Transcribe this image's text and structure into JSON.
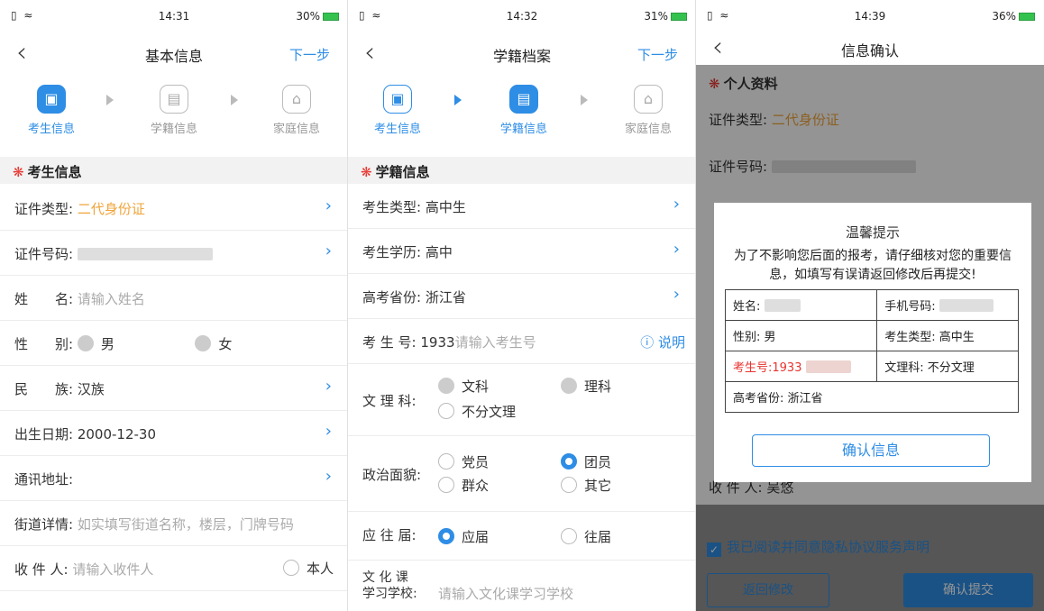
{
  "p1": {
    "status": {
      "left": "▯ ≈",
      "time": "14:31",
      "battery": "30%"
    },
    "nav": {
      "back": "‹",
      "title": "基本信息",
      "next": "下一步"
    },
    "steps": [
      "考生信息",
      "学籍信息",
      "家庭信息"
    ],
    "section": "考生信息",
    "star": "❋",
    "rows": {
      "id_type_k": "证件类型:",
      "id_type_v": "二代身份证",
      "id_no_k": "证件号码:",
      "name_k": "姓　　名:",
      "name_ph": "请输入姓名",
      "gender_k": "性　　别:",
      "male": "男",
      "female": "女",
      "nation_k": "民　　族:",
      "nation_v": "汉族",
      "birth_k": "出生日期:",
      "birth_v": "2000-12-30",
      "addr_k": "通讯地址:",
      "street_k": "街道详情:",
      "street_ph": "如实填写街道名称，楼层，门牌号码",
      "recv_k": "收 件 人:",
      "recv_ph": "请输入收件人",
      "self": "本人"
    },
    "chevron": "›"
  },
  "p2": {
    "status": {
      "left": "▯ ≈",
      "time": "14:32",
      "battery": "31%"
    },
    "nav": {
      "back": "‹",
      "title": "学籍档案",
      "next": "下一步"
    },
    "steps": [
      "考生信息",
      "学籍信息",
      "家庭信息"
    ],
    "section": "学籍信息",
    "rows": {
      "type_k": "考生类型:",
      "type_v": "高中生",
      "edu_k": "考生学历:",
      "edu_v": "高中",
      "prov_k": "高考省份:",
      "prov_v": "浙江省",
      "no_k": "考 生 号:",
      "no_v": "1933",
      "no_ph": "请输入考生号",
      "explain": "ⓘ 说明",
      "wl_k": "文 理 科:",
      "wl_1": "文科",
      "wl_2": "理科",
      "wl_3": "不分文理",
      "pol_k": "政治面貌:",
      "pol_1": "党员",
      "pol_2": "团员",
      "pol_3": "群众",
      "pol_4": "其它",
      "fresh_k": "应 往 届:",
      "fresh_1": "应届",
      "fresh_2": "往届",
      "school_k1": "文 化 课",
      "school_k2": "学习学校:",
      "school_ph": "请输入文化课学习学校"
    }
  },
  "p3": {
    "status": {
      "left": "▯ ≈",
      "time": "14:39",
      "battery": "36%"
    },
    "nav": {
      "back": "‹",
      "title": "信息确认"
    },
    "section": "个人资料",
    "bg": {
      "id_type_k": "证件类型:",
      "id_type_v": "二代身份证",
      "id_no_k": "证件号码:",
      "recv": "收 件 人: 吴悠"
    },
    "dialog": {
      "title": "温馨提示",
      "msg": "为了不影响您后面的报考，请仔细核对您的重要信息，如填写有误请返回修改后再提交!",
      "name": "姓名:",
      "phone": "手机号码:",
      "gender": "性别: 男",
      "type": "考生类型: 高中生",
      "no": "考生号:1933",
      "wl": "文理科: 不分文理",
      "prov": "高考省份: 浙江省",
      "confirm": "确认信息"
    },
    "agree": "我已阅读并同意隐私协议服务声明",
    "back_btn": "返回修改",
    "submit_btn": "确认提交"
  }
}
